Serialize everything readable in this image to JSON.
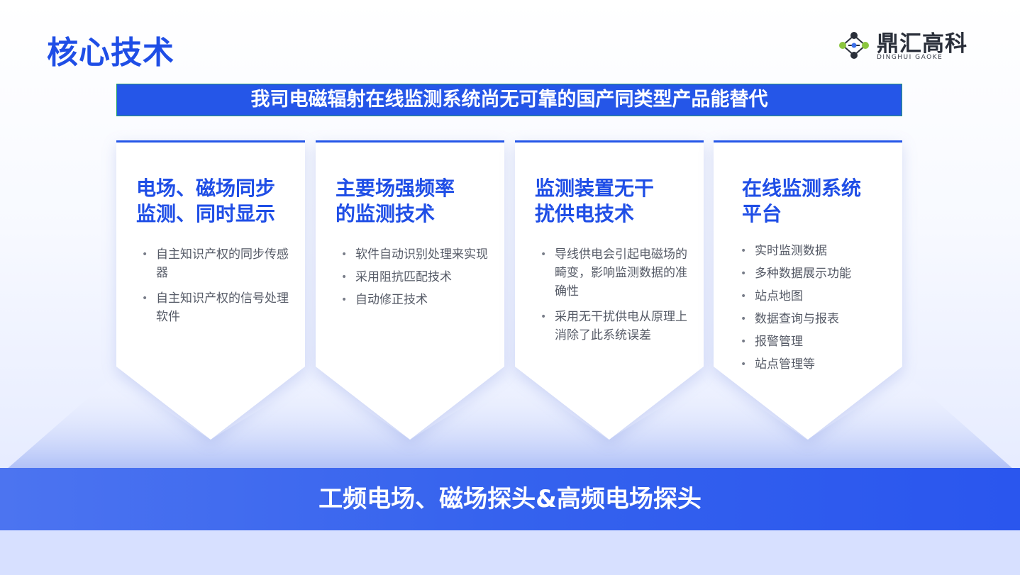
{
  "header": {
    "title": "核心技术",
    "logo_text": "鼎汇高科",
    "logo_subtitle": "DINGHUI GAOKE"
  },
  "banner": {
    "text": "我司电磁辐射在线监测系统尚无可靠的国产同类型产品能替代"
  },
  "cards": [
    {
      "title_lines": [
        "电场、磁场同步",
        "监测、同时显示"
      ],
      "items": [
        "自主知识产权的同步传感器",
        "自主知识产权的信号处理软件"
      ]
    },
    {
      "title_lines": [
        "主要场强频率",
        "的监测技术"
      ],
      "items": [
        "软件自动识别处理来实现",
        "采用阻抗匹配技术",
        "自动修正技术"
      ]
    },
    {
      "title_lines": [
        "监测装置无干",
        "扰供电技术"
      ],
      "items": [
        "导线供电会引起电磁场的畸变，影响监测数据的准确性",
        "采用无干扰供电从原理上消除了此系统误差"
      ]
    },
    {
      "title_lines": [
        "在线监测系统",
        "平台"
      ],
      "items": [
        "实时监测数据",
        "多种数据展示功能",
        "站点地图",
        "数据查询与报表",
        "报警管理",
        "站点管理等"
      ]
    }
  ],
  "footer": {
    "band_text": "工频电场、磁场探头&高频电场探头"
  },
  "colors": {
    "accent": "#1f4ee6",
    "banner": "#2556e8",
    "body_text": "#555a66"
  },
  "icons": {
    "logo": "molecule-network-icon"
  }
}
